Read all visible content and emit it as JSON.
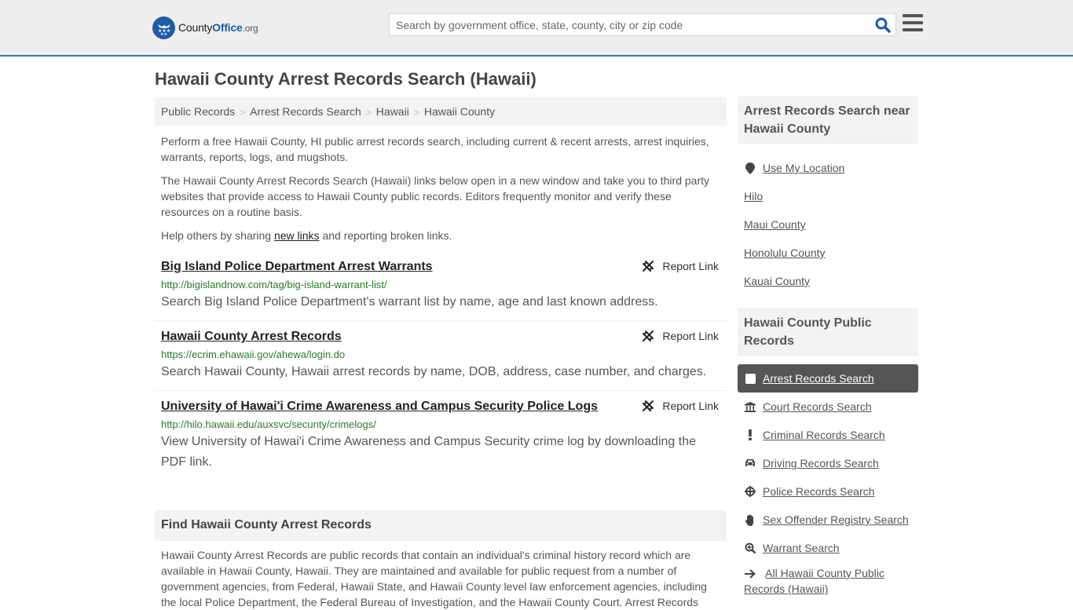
{
  "header": {
    "logo": {
      "county": "County",
      "office": "Office",
      "org": ".org"
    },
    "search_placeholder": "Search by government office, state, county, city or zip code",
    "colors": {
      "brand": "#1d5da8",
      "accent_border": "#3e77a8"
    }
  },
  "page": {
    "title": "Hawaii County Arrest Records Search (Hawaii)"
  },
  "breadcrumb": [
    {
      "label": "Public Records"
    },
    {
      "label": "Arrest Records Search"
    },
    {
      "label": "Hawaii"
    },
    {
      "label": "Hawaii County"
    }
  ],
  "intro": {
    "p1": "Perform a free Hawaii County, HI public arrest records search, including current & recent arrests, arrest inquiries, warrants, reports, logs, and mugshots.",
    "p2": "The Hawaii County Arrest Records Search (Hawaii) links below open in a new window and take you to third party websites that provide access to Hawaii County public records. Editors frequently monitor and verify these resources on a routine basis.",
    "p3_before": "Help others by sharing ",
    "p3_link": "new links",
    "p3_after": " and reporting broken links."
  },
  "results": [
    {
      "title": "Big Island Police Department Arrest Warrants",
      "url": "http://bigislandnow.com/tag/big-island-warrant-list/",
      "description": "Search Big Island Police Department's warrant list by name, age and last known address.",
      "report_label": "Report Link"
    },
    {
      "title": "Hawaii County Arrest Records",
      "url": "https://ecrim.ehawaii.gov/ahewa/login.do",
      "description": "Search Hawaii County, Hawaii arrest records by name, DOB, address, case number, and charges.",
      "report_label": "Report Link"
    },
    {
      "title": "University of Hawai'i Crime Awareness and Campus Security Police Logs",
      "url": "http://hilo.hawaii.edu/auxsvc/security/crimelogs/",
      "description": "View University of Hawai'i Crime Awareness and Campus Security crime log by downloading the PDF link.",
      "report_label": "Report Link"
    }
  ],
  "find": {
    "heading": "Find Hawaii County Arrest Records",
    "text": "Hawaii County Arrest Records are public records that contain an individual's criminal history record which are available in Hawaii County, Hawaii. They are maintained and available for public request from a number of government agencies, from Federal, Hawaii State, and Hawaii County level law enforcement agencies, including the local Police Department, the Federal Bureau of Investigation, and the Hawaii County Court. Arrest Records"
  },
  "sidebar": {
    "nearby_heading": "Arrest Records Search near Hawaii County",
    "use_location": "Use My Location",
    "nearby": [
      "Hilo",
      "Maui County",
      "Honolulu County",
      "Kauai County"
    ],
    "records_heading": "Hawaii County Public Records",
    "records": [
      {
        "label": "Arrest Records Search",
        "icon": "square-icon",
        "active": true
      },
      {
        "label": "Court Records Search",
        "icon": "courthouse-icon"
      },
      {
        "label": "Criminal Records Search",
        "icon": "exclamation-icon"
      },
      {
        "label": "Driving Records Search",
        "icon": "car-icon"
      },
      {
        "label": "Police Records Search",
        "icon": "crosshairs-icon"
      },
      {
        "label": "Sex Offender Registry Search",
        "icon": "hand-icon"
      },
      {
        "label": "Warrant Search",
        "icon": "zoom-in-icon"
      }
    ],
    "all_records": "All Hawaii County Public Records (Hawaii)"
  }
}
